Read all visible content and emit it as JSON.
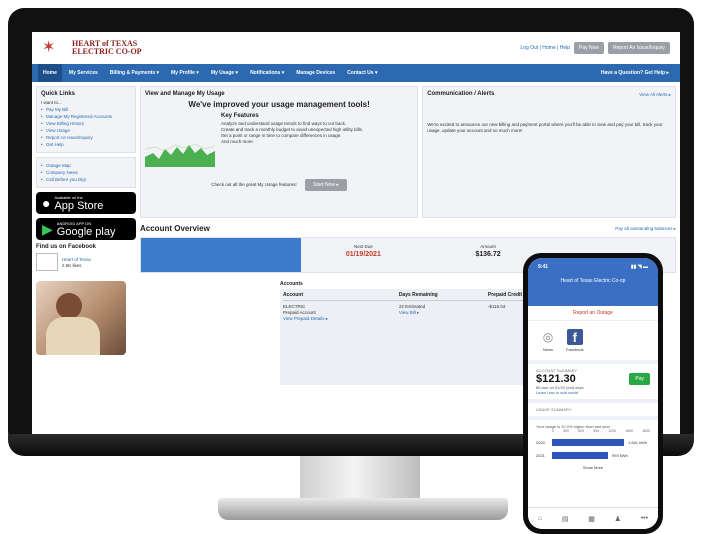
{
  "header": {
    "logo_line1": "HEART of TEXAS",
    "logo_line2": "ELECTRIC CO-OP",
    "links": "Log Out | Home | Help",
    "pay_button": "Pay Now",
    "outage_button": "Report An Issue/Inquiry"
  },
  "nav": {
    "items": [
      "Home",
      "My Services",
      "Billing & Payments ▾",
      "My Profile ▾",
      "My Usage ▾",
      "Notifications ▾",
      "Manage Devices",
      "Contact Us ▾"
    ],
    "right": "Have a Question? Get Help ▸"
  },
  "sidebar": {
    "quick_links_title": "Quick Links",
    "iwant": "I want to...",
    "links": [
      "Pay My Bill",
      "Manage My Registered Accounts",
      "View Billing History",
      "View Usage",
      "Report An Issue/Inquiry",
      "Get Help"
    ],
    "links2": [
      "Outage Map",
      "Company News",
      "Call Before you Dig!"
    ],
    "appstore_small": "Available on the",
    "appstore_big": "App Store",
    "gplay_small": "ANDROID APP ON",
    "gplay_big": "Google play",
    "facebook_title": "Find us on Facebook",
    "fb_name": "Heart of Texas",
    "fb_likes": "2.5K likes"
  },
  "usage": {
    "panel_title": "View and Manage My Usage",
    "headline": "We've improved your usage management tools!",
    "kf_title": "Key Features",
    "f1": "Analyze and understand usage trends to find ways to cut back.",
    "f2": "Create and track a monthly budget to avoid unexpected high utility bills.",
    "f3": "Set a point or range in time to compare differences in usage.",
    "f4": "And much more.",
    "cta_text": "Check out all the great My Usage features!",
    "start_btn": "Start Now ▸"
  },
  "comm": {
    "title": "Communication / Alerts",
    "view_all": "View All Alerts ▸",
    "body": "We're excited to announce our new billing and payment portal where you'll be able to view and pay your bill, track your usage, update your account and so much more!"
  },
  "overview": {
    "title": "Account Overview",
    "pay_all": "Pay all outstanding balances ▸",
    "due_label": "Next Due",
    "due_val": "01/19/2021",
    "amount_label": "Amount",
    "amount_val": "$136.72"
  },
  "accounts": {
    "caption": "Accounts",
    "headers": [
      "Account",
      "Days Remaining",
      "Prepaid Credit"
    ],
    "acct_type": "ELECTRIC",
    "acct_desc": "Prepaid Account",
    "acct_link": "View Prepaid Details ▸",
    "days": "22 Estimated",
    "days_link": "View Bill ▸",
    "credit": "-$116.04"
  },
  "phone": {
    "time": "9:41",
    "signal": "▮▮ ◥ ▬",
    "title": "Heart of Texas Electric Co-op",
    "report": "Report an Outage",
    "news": "News",
    "facebook": "Facebook",
    "prepaid_label": "ACCOUNT SUMMARY",
    "amount": "$121.30",
    "pay": "Pay",
    "note": "$0 due on 01/20 (est) days",
    "link": "Learn how to add credit",
    "usage_label": "USAGE SUMMARY",
    "usage_note": "Your usage is 10.0% higher than last year",
    "axis": [
      "0",
      "300",
      "600",
      "900",
      "1200",
      "1500",
      "1800"
    ],
    "bars": [
      {
        "label": "2020",
        "val": "1,641 kWh"
      },
      {
        "label": "2021",
        "val": "993 kWh"
      }
    ],
    "more": "Show More",
    "tabs": [
      "⌂",
      "▤",
      "▦",
      "♟",
      "•••"
    ]
  },
  "colors": {
    "nav_blue": "#2c69b0",
    "alert_red": "#c0392b",
    "pay_green": "#27a844"
  }
}
